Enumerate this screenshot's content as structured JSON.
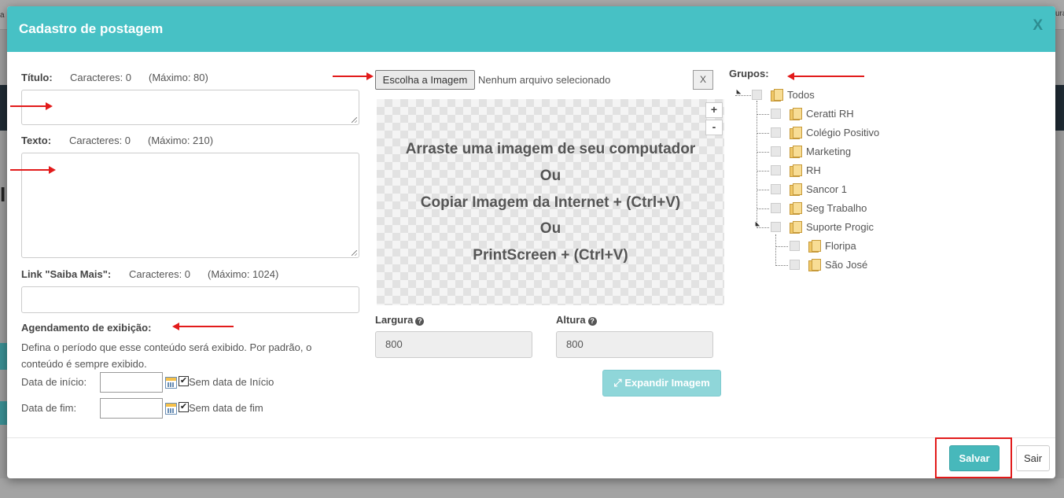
{
  "modal": {
    "title": "Cadastro de postagem",
    "close": "X"
  },
  "titulo": {
    "label": "Título:",
    "count": "Caracteres: 0",
    "max": "(Máximo: 80)"
  },
  "texto": {
    "label": "Texto:",
    "count": "Caracteres: 0",
    "max": "(Máximo: 210)"
  },
  "link": {
    "label": "Link \"Saiba Mais\":",
    "count": "Caracteres: 0",
    "max": "(Máximo: 1024)"
  },
  "agendamento": {
    "label": "Agendamento de exibição:",
    "desc1": "Defina o período que esse conteúdo será exibido. Por padrão, o",
    "desc2": "conteúdo é sempre exibido.",
    "inicio_label": "Data de início:",
    "inicio_check": "Sem data de Início",
    "fim_label": "Data de fim:",
    "fim_check": "Sem data de fim"
  },
  "imagem": {
    "choose_label": "Escolha a Imagem",
    "no_file": "Nenhum arquivo selecionado",
    "clear": "X",
    "lines": [
      "Arraste uma imagem de seu computador",
      "Ou",
      "Copiar Imagem da Internet + (Ctrl+V)",
      "Ou",
      "PrintScreen + (Ctrl+V)"
    ],
    "zoom_in": "+",
    "zoom_out": "-",
    "largura_label": "Largura",
    "largura_value": "800",
    "altura_label": "Altura",
    "altura_value": "800",
    "expand_label": "Expandir Imagem"
  },
  "grupos": {
    "label": "Grupos:",
    "items": [
      "Todos",
      "Ceratti RH",
      "Colégio Positivo",
      "Marketing",
      "RH",
      "Sancor 1",
      "Seg Trabalho",
      "Suporte Progic",
      "Floripa",
      "São José"
    ]
  },
  "footer": {
    "save": "Salvar",
    "exit": "Sair"
  },
  "background": {
    "top_left": "a",
    "top_left2": "o",
    "top_right": "ura",
    "left_big": "I"
  }
}
